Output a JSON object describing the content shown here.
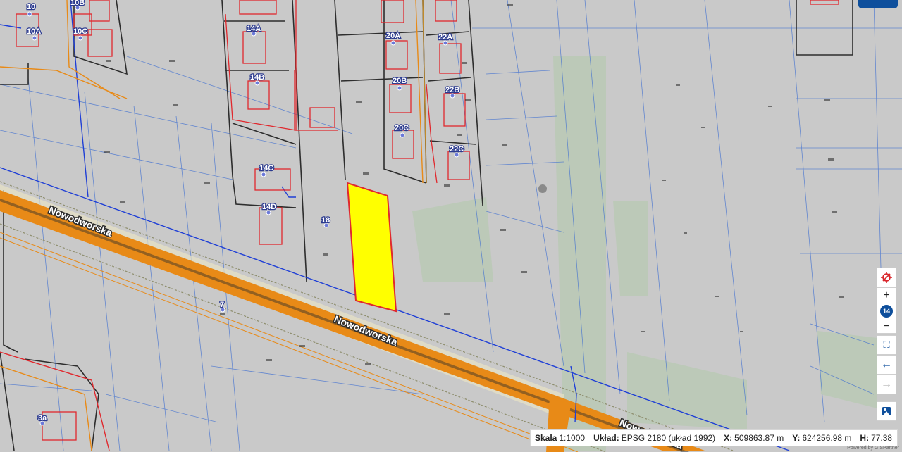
{
  "map": {
    "street_name": "Nowodworska",
    "address_labels": [
      "10",
      "10A",
      "10B",
      "10C",
      "14A",
      "14B",
      "14C",
      "14D",
      "18",
      "20A",
      "20B",
      "20C",
      "22A",
      "22B",
      "22C",
      "7",
      "3a"
    ],
    "colors": {
      "background": "#c9c9c9",
      "road_fill": "#e88a17",
      "highlight_parcel": "#ffff00",
      "parcel_outline": "#2d2d2d",
      "building_outline": "#e0282d",
      "utility_blue": "#1f3fd6",
      "vegetation": "#b9c9b4"
    }
  },
  "controls": {
    "locate": "target-icon",
    "zoom_in": "+",
    "zoom_level": "14",
    "zoom_out": "−",
    "fullscreen": "⛶",
    "back": "←",
    "forward": "→",
    "layers": "layers-icon"
  },
  "statusbar": {
    "scale_label": "Skala",
    "scale_value": "1:1000",
    "crs_label": "Układ:",
    "crs_value": "EPSG 2180 (układ 1992)",
    "x_label": "X:",
    "x_value": "509863.87 m",
    "y_label": "Y:",
    "y_value": "624256.98 m",
    "h_label": "H:",
    "h_value": "77.38"
  },
  "footer": {
    "powered_by": "Powered by GISPartner"
  }
}
